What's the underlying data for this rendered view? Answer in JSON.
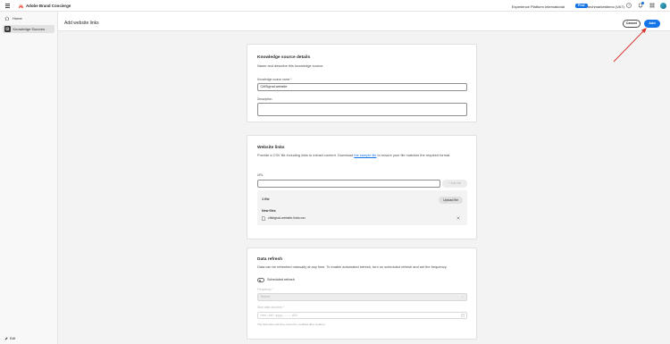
{
  "topbar": {
    "app_name": "Adobe Brand Concierge",
    "org": "Experience Platform International",
    "env_badge": "Prod",
    "sandbox": "techmarketdemo (VA7)",
    "notification_count": "3"
  },
  "sidebar": {
    "items": [
      {
        "label": "Home",
        "icon": "home-icon"
      },
      {
        "label": "Knowledge Sources",
        "icon": "knowledge-sources-icon"
      }
    ],
    "edit_label": "Edit"
  },
  "header": {
    "title": "Add website links",
    "cancel_label": "Cancel",
    "add_label": "Add"
  },
  "details": {
    "heading": "Knowledge source details",
    "description": "Name and describe this knowledge source.",
    "name_label": "Knowledge source name ",
    "name_required": "*",
    "name_value": "CitiSignal website",
    "desc_label": "Description",
    "desc_value": ""
  },
  "links": {
    "heading": "Website links",
    "text_before": "Provide a CSV file including links to extract content. Download ",
    "link_text": "the sample file",
    "text_after": " to ensure your file matches the required format.",
    "url_label": "URL",
    "url_value": "",
    "add_link_label": "Add link",
    "file_count": "1 file",
    "upload_label": "Upload file",
    "new_files_label": "New files",
    "file_name": "citisignal-website-links.csv"
  },
  "refresh": {
    "heading": "Data refresh",
    "description": "Data can be refreshed manually at any time. To enable automated refresh, turn on scheduled refresh and set the frequency.",
    "toggle_label": "Scheduled refresh",
    "toggle_on": false,
    "frequency_label": "Frequency *",
    "frequency_value": "Select",
    "start_label": "Start date and time *",
    "start_placeholder": "mm / dd / yyyy, -- : -- AM",
    "hint": "The start date and time cannot be modified after creation."
  },
  "colors": {
    "accent": "#1473e6",
    "annotation": "#d9342b"
  }
}
